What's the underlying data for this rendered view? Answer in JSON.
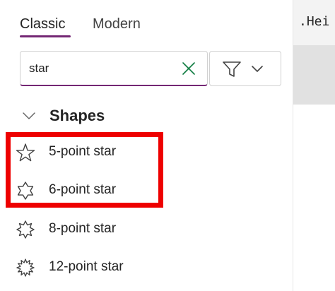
{
  "tabs": {
    "classic": "Classic",
    "modern": "Modern"
  },
  "search": {
    "value": "star",
    "clear_icon": "close-icon",
    "filter_icon": "filter-icon"
  },
  "section": {
    "title": "Shapes",
    "expanded": true
  },
  "items": [
    {
      "label": "5-point star",
      "icon": "star-5-icon"
    },
    {
      "label": "6-point star",
      "icon": "star-6-icon"
    },
    {
      "label": "8-point star",
      "icon": "star-8-icon"
    },
    {
      "label": "12-point star",
      "icon": "star-12-icon"
    }
  ],
  "editor": {
    "formula_fragment": ".Hei"
  },
  "colors": {
    "accent": "#742774",
    "highlight": "#ee0000"
  }
}
